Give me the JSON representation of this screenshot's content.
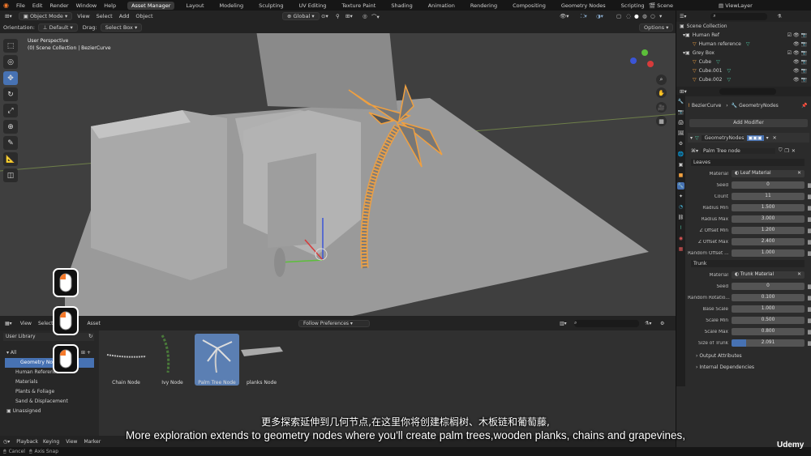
{
  "menu": [
    "File",
    "Edit",
    "Render",
    "Window",
    "Help"
  ],
  "workspaces": [
    "Asset Manager",
    "Layout",
    "Modeling",
    "Sculpting",
    "UV Editing",
    "Texture Paint",
    "Shading",
    "Animation",
    "Rendering",
    "Compositing",
    "Geometry Nodes",
    "Scripting"
  ],
  "scene": "Scene",
  "view_layer": "ViewLayer",
  "viewport": {
    "mode": "Object Mode",
    "menus": [
      "View",
      "Select",
      "Add",
      "Object"
    ],
    "transform": "Global",
    "orientation_label": "Orientation:",
    "orientation": "Default",
    "drag_label": "Drag:",
    "drag": "Select Box",
    "options": "Options",
    "perspective": "User Perspective",
    "collection_info": "(0) Scene Collection | BezierCurve"
  },
  "outliner": {
    "rows": [
      {
        "label": "Scene Collection",
        "indent": 0
      },
      {
        "label": "Human Ref",
        "indent": 1
      },
      {
        "label": "Human reference",
        "indent": 2
      },
      {
        "label": "Grey Box",
        "indent": 1
      },
      {
        "label": "Cube",
        "indent": 2
      },
      {
        "label": "Cube.001",
        "indent": 2
      },
      {
        "label": "Cube.002",
        "indent": 2
      }
    ]
  },
  "properties": {
    "object": "BezierCurve",
    "modifier_tab": "GeometryNodes",
    "add_modifier": "Add Modifier",
    "modifier_name": "GeometryNodes",
    "node_group": "Palm Tree node",
    "leaves_header": "Leaves",
    "leaves_material_label": "Material",
    "leaves_material": "Leaf Material",
    "leaves_fields": [
      {
        "label": "Seed",
        "value": "0"
      },
      {
        "label": "Count",
        "value": "11"
      },
      {
        "label": "Radius Min",
        "value": "1.500"
      },
      {
        "label": "Radius Max",
        "value": "3.000"
      },
      {
        "label": "Z Offset Min",
        "value": "1.200"
      },
      {
        "label": "Z Offset Max",
        "value": "2.400"
      },
      {
        "label": "Random Offset ...",
        "value": "1.000"
      }
    ],
    "trunk_header": "Trunk",
    "trunk_material_label": "Material",
    "trunk_material": "Trunk Material",
    "trunk_fields": [
      {
        "label": "Seed",
        "value": "0"
      },
      {
        "label": "Random Rotatio...",
        "value": "0.100"
      },
      {
        "label": "Base Scale",
        "value": "1.000"
      },
      {
        "label": "Scale Min",
        "value": "0.500"
      },
      {
        "label": "Scale Max",
        "value": "0.800"
      },
      {
        "label": "Size of Trunk",
        "value": "2.091"
      }
    ],
    "output_attributes": "Output Attributes",
    "internal_dependencies": "Internal Dependencies"
  },
  "asset_browser": {
    "menus": [
      "View",
      "Select",
      "Asset"
    ],
    "library": "User Library",
    "filter": "Follow Preferences",
    "all": "All",
    "categories": [
      "Geometry Nodes",
      "Human Reference",
      "Materials",
      "Plants & Foliage",
      "Sand & Displacement"
    ],
    "unassigned": "Unassigned",
    "assets": [
      "Chain Node",
      "Ivy Node",
      "Palm Tree Node",
      "planks Node"
    ],
    "selected_asset": "Palm Tree Node"
  },
  "timeline": {
    "menus": [
      "Playback",
      "Keying",
      "View",
      "Marker"
    ]
  },
  "statusbar": {
    "cancel": "Cancel",
    "axis_snap": "Axis Snap"
  },
  "subtitles": {
    "chinese": "更多探索延伸到几何节点,在这里你将创建棕榈树、木板链和葡萄藤,",
    "english": "More exploration extends to geometry nodes where you'll create palm trees,wooden planks, chains and grapevines,"
  },
  "watermark": "Udemy",
  "colors": {
    "accent": "#4772b3",
    "selection": "#f0a040",
    "viewport": "#3f3f3f"
  }
}
